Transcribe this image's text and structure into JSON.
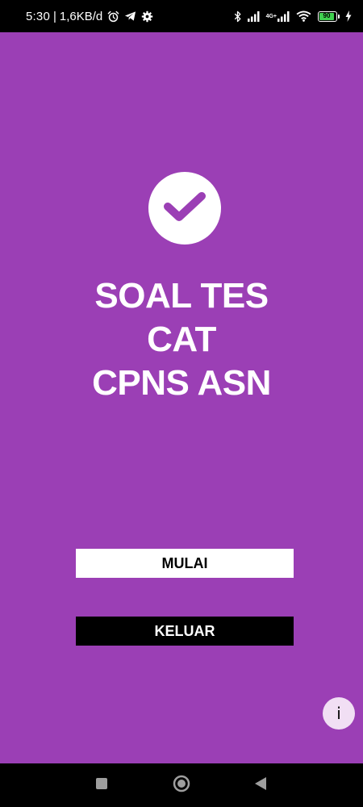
{
  "status_bar": {
    "time": "5:30",
    "separator": "|",
    "speed": "1,6KB/d",
    "network_label": "4G+",
    "battery_level": "90",
    "battery_fraction": 0.9,
    "icons_left": [
      "alarm-icon",
      "telegram-icon",
      "gear-icon"
    ],
    "icons_right": [
      "bluetooth-icon",
      "signal-icon",
      "signal-4g-icon",
      "wifi-icon",
      "battery-icon",
      "charging-icon"
    ]
  },
  "main": {
    "badge_icon": "checkmark-icon",
    "title_lines": [
      "SOAL TES",
      "CAT",
      "CPNS ASN"
    ],
    "start_button": "MULAI",
    "exit_button": "KELUAR",
    "info_button": "i"
  },
  "nav_bar": {
    "icons": [
      "recent-apps-icon",
      "home-icon",
      "back-icon"
    ]
  },
  "colors": {
    "background": "#9b3fb5",
    "start_button_bg": "#ffffff",
    "exit_button_bg": "#000000",
    "info_button_bg": "#f1dff4",
    "battery_fill": "#3fd14f"
  }
}
